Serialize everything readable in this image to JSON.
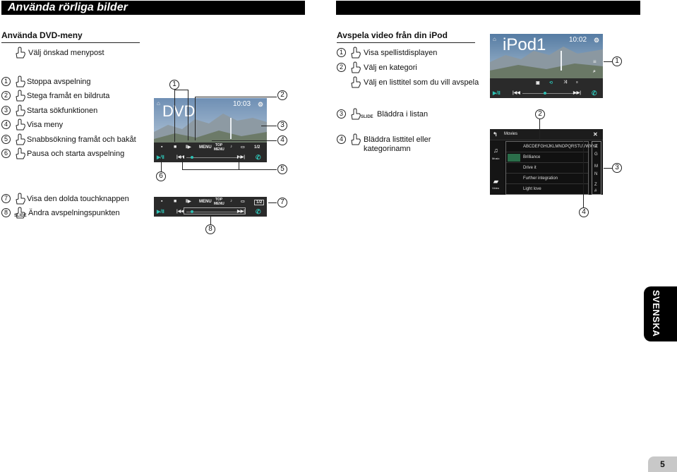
{
  "header": {
    "title": "Använda rörliga bilder"
  },
  "left_section": {
    "title": "Använda DVD-meny",
    "menu_row": "Välj önskad menypost",
    "items": [
      {
        "num": "1",
        "text": "Stoppa avspelning"
      },
      {
        "num": "2",
        "text": "Stega framåt en bildruta"
      },
      {
        "num": "3",
        "text": "Starta sökfunktionen"
      },
      {
        "num": "4",
        "text": "Visa meny"
      },
      {
        "num": "5",
        "text": "Snabbsökning framåt och bakåt"
      },
      {
        "num": "6",
        "text": "Pausa och starta avspelning"
      }
    ],
    "items2": [
      {
        "num": "7",
        "text": "Visa den dolda touchknappen"
      },
      {
        "num": "8",
        "text": "Ändra avspelningspunkten"
      }
    ]
  },
  "dvd_screen": {
    "label": "DVD",
    "time": "10:03",
    "menu_btn": "MENU",
    "top_menu_btn": "TOP MENU",
    "page_indicator": "1/2"
  },
  "dvd_callouts": [
    "1",
    "2",
    "3",
    "4",
    "5",
    "6"
  ],
  "bar_screen": {
    "menu_btn": "MENU",
    "top_menu_btn": "TOP MENU",
    "page_indicator": "1/2"
  },
  "bar_callouts": [
    "7",
    "8"
  ],
  "right_section": {
    "title": "Avspela video från din iPod",
    "items": [
      {
        "num": "1",
        "text": "Visa spellistdisplayen"
      },
      {
        "num": "2",
        "text": "Välj en kategori"
      },
      {
        "num": "",
        "text": "Välj en listtitel som du vill avspela"
      },
      {
        "num": "3",
        "text": "Bläddra i listan"
      },
      {
        "num": "4",
        "text": "Bläddra listtitel eller kategorinamn"
      }
    ],
    "item4_line1": "Bläddra listtitel eller",
    "item4_line2": "kategorinamn"
  },
  "ipod_screen": {
    "label": "iPod1",
    "time": "10:02"
  },
  "movies_screen": {
    "title": "Movies",
    "left_labels": [
      "Music",
      "Video"
    ],
    "list": [
      "ABCDEFGHIJKLMNOPQRSTUVWXYZ",
      "Brilliance",
      "Drive it",
      "Further integration",
      "Light love"
    ],
    "index": [
      "A",
      "G",
      "M",
      "N",
      "Z",
      "#"
    ]
  },
  "ipod_callouts": [
    "1",
    "2",
    "3",
    "4"
  ],
  "slide_tag": "SLIDE",
  "side_tab": "SVENSKA",
  "page_number": "5",
  "colors": {
    "accent": "#2ec1b4",
    "title_bg": "#000000",
    "tab_bg": "#c8c8c8"
  }
}
